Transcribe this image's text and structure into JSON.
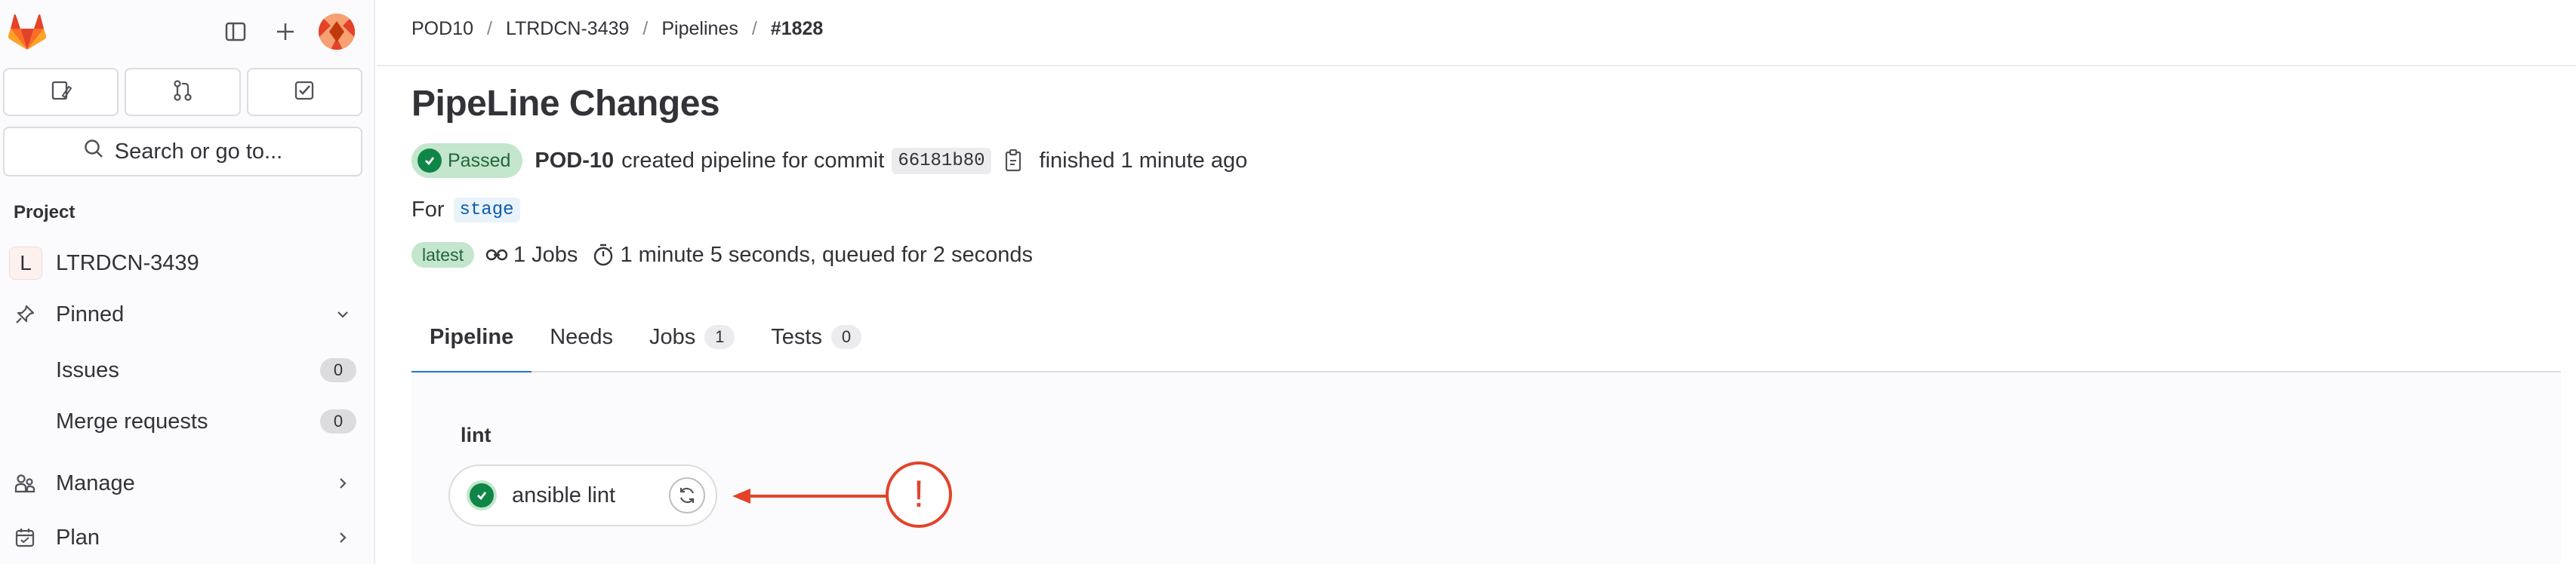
{
  "sidebar": {
    "search_label": "Search or go to...",
    "section_title": "Project",
    "project": {
      "initial": "L",
      "name": "LTRDCN-3439"
    },
    "items": [
      {
        "label": "Pinned",
        "icon": "pin-icon"
      },
      {
        "label": "Issues",
        "count": "0"
      },
      {
        "label": "Merge requests",
        "count": "0"
      },
      {
        "label": "Manage",
        "icon": "users-icon"
      },
      {
        "label": "Plan",
        "icon": "calendar-icon"
      }
    ]
  },
  "breadcrumb": [
    "POD10",
    "LTRDCN-3439",
    "Pipelines",
    "#1828"
  ],
  "page": {
    "title": "PipeLine Changes",
    "status": "Passed",
    "author": "POD-10",
    "action_text": "created pipeline for commit",
    "commit_sha": "66181b80",
    "finished_text": "finished 1 minute ago",
    "for_label": "For",
    "ref": "stage",
    "latest_label": "latest",
    "jobs_text": "1 Jobs",
    "duration_text": "1 minute 5 seconds, queued for 2 seconds"
  },
  "tabs": [
    {
      "label": "Pipeline",
      "active": true
    },
    {
      "label": "Needs"
    },
    {
      "label": "Jobs",
      "count": "1"
    },
    {
      "label": "Tests",
      "count": "0"
    }
  ],
  "pipeline_graph": {
    "stage": "lint",
    "job": {
      "name": "ansible lint",
      "status": "passed"
    },
    "annotation_symbol": "!"
  },
  "colors": {
    "accent": "#1f75cb",
    "success": "#108548",
    "success_bg": "#c3e6cd",
    "annotation": "#e24329",
    "brand": "#fc6d26"
  }
}
